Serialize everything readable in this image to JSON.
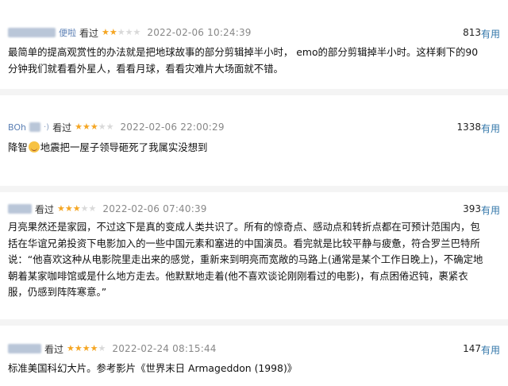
{
  "reviews": [
    {
      "user": "便啦",
      "status": "看过",
      "stars": 2,
      "time": "2022-02-06 10:24:39",
      "votes": "813",
      "useful_label": "有用",
      "text": "最简单的提高观赏性的办法就是把地球故事的部分剪辑掉半小时， emo的部分剪辑掉半小时。这样剩下的90分钟我们就看看外星人，看看月球，看看灾难片大场面就不错。"
    },
    {
      "user": "BOh",
      "status": "看过",
      "stars": 3,
      "time": "2022-02-06 22:00:29",
      "votes": "1338",
      "useful_label": "有用",
      "text_before": "降智",
      "text_after": "地震把一屋子领导砸死了我属实没想到"
    },
    {
      "user": "",
      "status": "看过",
      "stars": 3,
      "time": "2022-02-06 07:40:39",
      "votes": "393",
      "useful_label": "有用",
      "text": "月亮果然还是家园，不过这下是真的变成人类共识了。所有的惊奇点、感动点和转折点都在可预计范围内，包括在华谊兄弟投资下电影加入的一些中国元素和塞进的中国演员。看完就是比较平静与疲惫，符合罗兰巴特所说：“他喜欢这种从电影院里走出来的感觉，重新来到明亮而宽敞的马路上(通常是某个工作日晚上)，不确定地朝着某家咖啡馆或是什么地方走去。他默默地走着(他不喜欢谈论刚刚看过的电影)，有点困倦迟钝，裹紧衣服，仍感到阵阵寒意。”"
    },
    {
      "user": "",
      "status": "看过",
      "stars": 4,
      "time": "2022-02-24 08:15:44",
      "votes": "147",
      "useful_label": "有用",
      "text": "标准美国科幻大片。参考影片《世界末日 Armageddon (1998)》"
    }
  ]
}
